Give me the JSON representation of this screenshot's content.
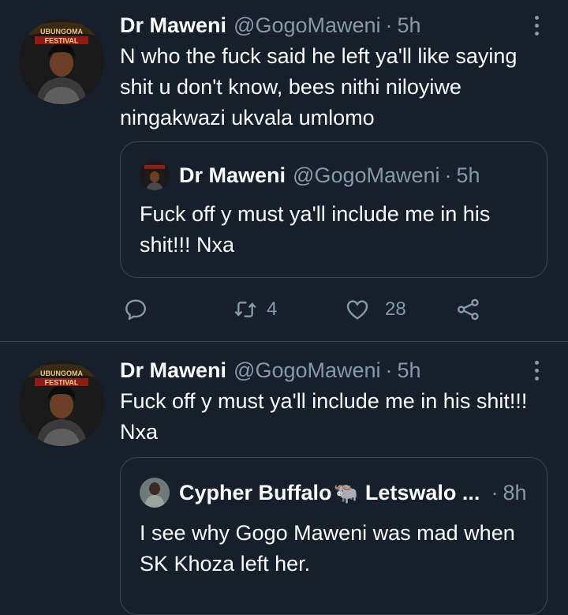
{
  "tweets": [
    {
      "name": "Dr Maweni",
      "handle": "@GogoMaweni",
      "sep": "·",
      "time": "5h",
      "avatar_text": [
        "UBUNGOMA",
        "FESTIVAL"
      ],
      "text": "N who the fuck said he left ya'll like saying shit u don't know, bees nithi niloyiwe ningakwazi ukvala umlomo",
      "quote": {
        "name": "Dr Maweni",
        "handle": "@GogoMaweni",
        "sep": "·",
        "time": "5h",
        "text": "Fuck off y must ya'll include me in his shit!!! Nxa"
      },
      "actions": {
        "reply_icon": "reply-icon",
        "retweet_icon": "retweet-icon",
        "retweet_count": "4",
        "like_icon": "heart-icon",
        "like_count": "28",
        "share_icon": "share-icon"
      }
    },
    {
      "name": "Dr Maweni",
      "handle": "@GogoMaweni",
      "sep": "·",
      "time": "5h",
      "avatar_text": [
        "UBUNGOMA",
        "FESTIVAL"
      ],
      "text": "Fuck off y must ya'll include me in his shit!!! Nxa",
      "quote": {
        "name": "Cypher Buffalo",
        "name_suffix": "Letswalo ...",
        "emoji": "🐃",
        "sep": "·",
        "time": "8h",
        "text": "I see why Gogo Maweni  was mad when SK Khoza left her."
      }
    }
  ],
  "colors": {
    "background": "#15202b",
    "secondary_text": "#8899a6",
    "border": "#38444d"
  }
}
